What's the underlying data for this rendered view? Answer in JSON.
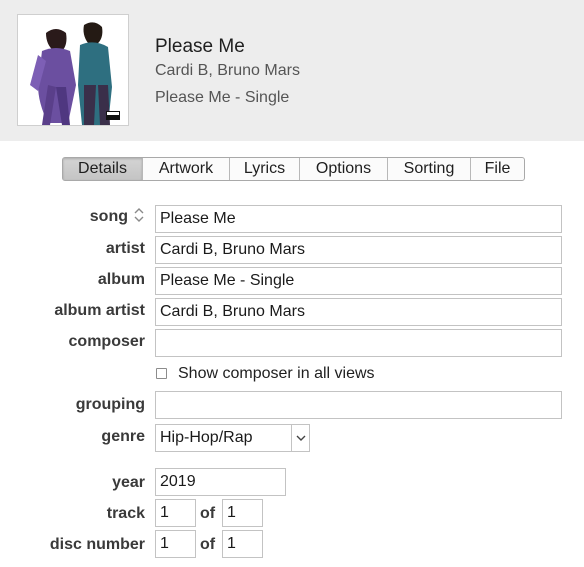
{
  "header": {
    "title": "Please Me",
    "artist": "Cardi B, Bruno Mars",
    "album": "Please Me - Single",
    "artwork_icon": "album-artwork"
  },
  "tabs": [
    "Details",
    "Artwork",
    "Lyrics",
    "Options",
    "Sorting",
    "File"
  ],
  "active_tab": "Details",
  "labels": {
    "song": "song",
    "artist": "artist",
    "album": "album",
    "album_artist": "album artist",
    "composer": "composer",
    "grouping": "grouping",
    "genre": "genre",
    "year": "year",
    "track": "track",
    "disc_number": "disc number",
    "of": "of"
  },
  "values": {
    "song": "Please Me",
    "artist": "Cardi B, Bruno Mars",
    "album": "Please Me - Single",
    "album_artist": "Cardi B, Bruno Mars",
    "composer": "",
    "grouping": "",
    "genre": "Hip-Hop/Rap",
    "year": "2019",
    "track": "1",
    "track_of": "1",
    "disc": "1",
    "disc_of": "1"
  },
  "show_composer": {
    "label": "Show composer in all views",
    "checked": false
  },
  "colors": {
    "header_bg": "#ededed",
    "active_tab_bg": "#c9c9c9",
    "field_border": "#c3c3c3"
  }
}
